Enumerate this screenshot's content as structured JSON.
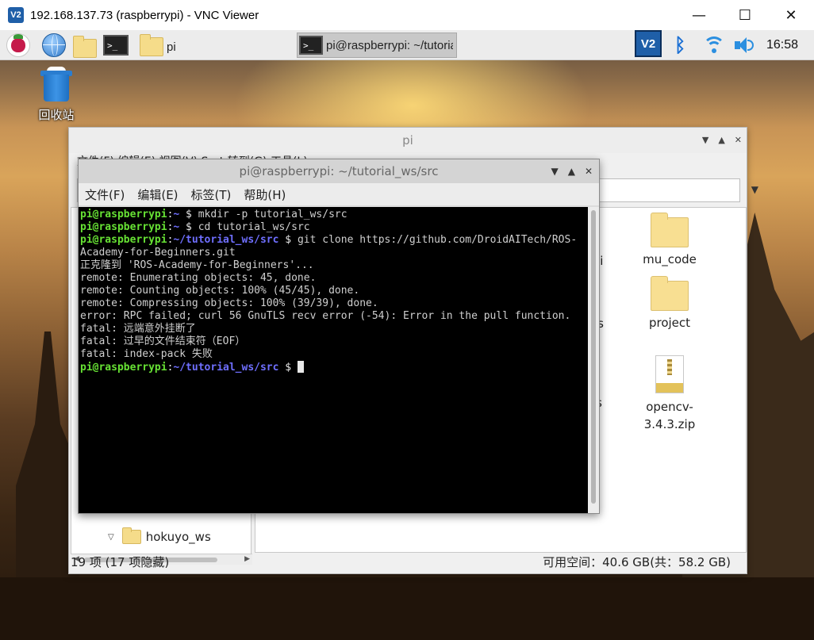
{
  "vnc": {
    "title": "192.168.137.73 (raspberrypi) - VNC Viewer",
    "logo": "V2",
    "minimize_glyph": "—",
    "maximize_glyph": "☐",
    "close_glyph": "✕"
  },
  "taskbar": {
    "items": [
      {
        "name": "raspberry-menu",
        "icon": "raspberry-icon"
      },
      {
        "name": "web-browser",
        "icon": "globe-icon"
      },
      {
        "name": "file-manager",
        "icon": "folder-icon"
      },
      {
        "name": "terminal",
        "icon": "terminal-icon"
      }
    ],
    "task_pi_label": "pi",
    "task_terminal_label": "pi@raspberrypi: ~/tutorial_ws/src",
    "tray_vnc_label": "V2",
    "clock": "16:58"
  },
  "desktop": {
    "trash_label": "回收站"
  },
  "file_manager": {
    "title": "pi",
    "menu_partial": "文件(F)   编辑(E)   视图(V)   Sort   转到(G)   工具(L)",
    "sidebar_item": "hokuyo_ws",
    "files": [
      {
        "label": "mu_code",
        "type": "folder"
      },
      {
        "label": "project",
        "type": "folder"
      },
      {
        "label": "opencv-3.4.3.zip",
        "type": "zip"
      }
    ],
    "partial_labels": [
      "gPi",
      "res",
      "os"
    ],
    "status_left": "19 项 (17 项隐藏)",
    "status_right": "可用空间：40.6 GB(共：58.2 GB)"
  },
  "terminal": {
    "title": "pi@raspberrypi: ~/tutorial_ws/src",
    "menu": [
      "文件(F)",
      "编辑(E)",
      "标签(T)",
      "帮助(H)"
    ],
    "lines": [
      {
        "user": "pi@raspberrypi",
        "path": "~",
        "cmd": "mkdir -p tutorial_ws/src"
      },
      {
        "user": "pi@raspberrypi",
        "path": "~",
        "cmd": "cd tutorial_ws/src"
      },
      {
        "user": "pi@raspberrypi",
        "path": "~/tutorial_ws/src",
        "cmd": "git clone https://github.com/DroidAITech/ROS-"
      },
      {
        "text": "Academy-for-Beginners.git"
      },
      {
        "text": "正克隆到 'ROS-Academy-for-Beginners'..."
      },
      {
        "text": "remote: Enumerating objects: 45, done."
      },
      {
        "text": "remote: Counting objects: 100% (45/45), done."
      },
      {
        "text": "remote: Compressing objects: 100% (39/39), done."
      },
      {
        "text": "error: RPC failed; curl 56 GnuTLS recv error (-54): Error in the pull function."
      },
      {
        "text": "fatal: 远端意外挂断了"
      },
      {
        "text": "fatal: 过早的文件结束符（EOF）"
      },
      {
        "text": "fatal: index-pack 失败"
      },
      {
        "user": "pi@raspberrypi",
        "path": "~/tutorial_ws/src",
        "cmd": "",
        "cursor": true
      }
    ]
  },
  "colors": {
    "prompt_user": "#67e234",
    "prompt_path": "#6f6fff",
    "vnc_blue": "#1f5fa8"
  }
}
